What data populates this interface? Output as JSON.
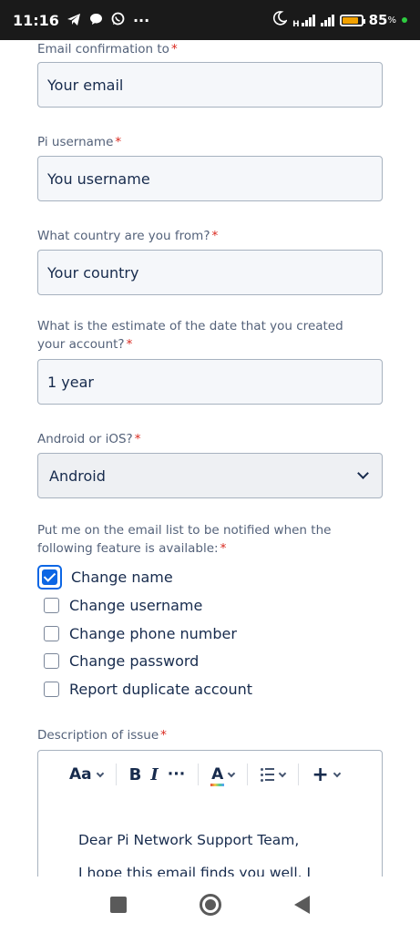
{
  "status_bar": {
    "time": "11:16",
    "more": "···",
    "battery_text": "85",
    "battery_level": 0.85,
    "network_type": "H"
  },
  "form": {
    "email": {
      "label": "Email confirmation to",
      "required": "*",
      "value": "Your email"
    },
    "username": {
      "label": "Pi username",
      "required": "*",
      "value": "You username"
    },
    "country": {
      "label": "What country are you from?",
      "required": "*",
      "value": "Your country"
    },
    "date": {
      "label": "What is the estimate of the date that you created your account?",
      "required": "*",
      "value": "1 year"
    },
    "platform": {
      "label": "Android or iOS?",
      "required": "*",
      "value": "Android"
    },
    "features": {
      "label": "Put me on the email list to be notified when the following feature is available:",
      "required": "*",
      "options": [
        {
          "label": "Change name",
          "checked": true
        },
        {
          "label": "Change username",
          "checked": false
        },
        {
          "label": "Change phone number",
          "checked": false
        },
        {
          "label": "Change password",
          "checked": false
        },
        {
          "label": "Report duplicate account",
          "checked": false
        }
      ]
    },
    "description": {
      "label": "Description of issue",
      "required": "*",
      "toolbar": {
        "text_style": "Aa",
        "bold": "B",
        "italic": "I",
        "more": "···",
        "text_color": "A",
        "insert": "+"
      },
      "body_line1": "Dear Pi Network Support Team,",
      "body_line2": "I hope this email finds you well. I"
    }
  },
  "colors": {
    "accent": "#0c66e4",
    "required": "#d9281e",
    "label": "#54627a",
    "text": "#172b4d"
  },
  "icons": {
    "status_left": [
      "telegram-icon",
      "chat-bubble-icon",
      "whatsapp-icon"
    ],
    "status_right": [
      "moon-icon",
      "signal-icon",
      "battery-icon"
    ],
    "nav": [
      "recents-square-icon",
      "home-circle-icon",
      "back-triangle-icon"
    ]
  }
}
